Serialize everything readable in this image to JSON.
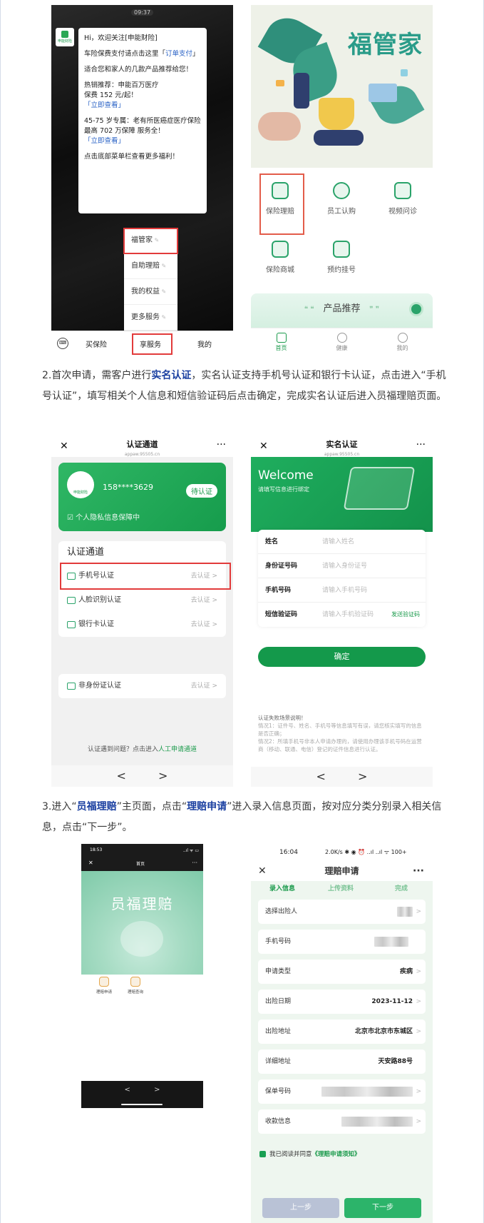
{
  "shot1": {
    "time": "09:37",
    "avatar_text": "申能财险",
    "msg_greeting": "Hi，欢迎关注[申能财险]",
    "msg_autopay_prefix": "车险保费支付请点击这里「",
    "msg_autopay_link": "订单支付",
    "msg_autopay_suffix": "」",
    "msg_recommend": "适合您和家人的几款产品推荐给您！",
    "msg_hot_title": "热销推荐：申能百万医疗",
    "msg_hot_price": "保费 152 元/起！",
    "msg_hot_link": "「立即查看」",
    "msg_age_title": "45-75 岁专属：老有所医癌症医疗保险",
    "msg_age_cover": "最高 702 万保障 服务全！",
    "msg_age_link": "「立即查看」",
    "msg_footer": "点击底部菜单栏查看更多福利！",
    "menu": [
      "福管家",
      "自助理赔",
      "我的权益",
      "更多服务"
    ],
    "tabs": [
      "买保险",
      "享服务",
      "我的"
    ]
  },
  "shot2": {
    "title": "福管家",
    "grid": [
      "保险理赔",
      "员工认购",
      "视频问诊",
      "保险商城",
      "预约挂号"
    ],
    "product_rec": "产品推荐",
    "bottom_tabs": [
      "首页",
      "健康",
      "我的"
    ]
  },
  "para2": {
    "part1": "2.首次申请，需客户进行",
    "bold1": "实名认证",
    "part2": "，实名认证支持手机号认证和银行卡认证，点击进入“手机号认证”，填写相关个人信息和短信验证码后点击确定，完成实名认证后进入员福理赔页面。"
  },
  "shot3": {
    "title": "认证通道",
    "url": "appaw.95505.cn",
    "logo_text": "申能财险",
    "phone": "158****3629",
    "badge": "待认证",
    "privacy": "个人隐私信息保障中",
    "section": "认证通道",
    "rows": [
      "手机号认证",
      "人脸识别认证",
      "银行卡认证"
    ],
    "row_action": "去认证 >",
    "row_extra": "非身份证认证",
    "help_prefix": "认证遇到问题？点击进入",
    "help_link": "人工申请通道",
    "nav": "<  >"
  },
  "shot4": {
    "title": "实名认证",
    "url": "appaw.95505.cn",
    "welcome": "Welcome",
    "welcome_sub": "请填写信息进行绑定",
    "fields": [
      {
        "label": "姓名",
        "ph": "请输入姓名"
      },
      {
        "label": "身份证号码",
        "ph": "请输入身份证号"
      },
      {
        "label": "手机号码",
        "ph": "请输入手机号码"
      },
      {
        "label": "短信验证码",
        "ph": "请输入手机验证码"
      }
    ],
    "sms_btn": "发送验证码",
    "confirm": "确定",
    "note_title": "认证失败场景说明！",
    "note_1": "情况1：证件号、姓名、手机号等信息填写有误，请您核实填写的信息是否正确；",
    "note_2": "情况2：所填手机号非本人申请办理的，请使用办理该手机号码在运营商（移动、联通、电信）登记的证件信息进行认证。",
    "nav": "<  >"
  },
  "para3": {
    "part1": "3.进入“",
    "bold1": "员福理赔",
    "part2": "”主页面，点击“",
    "bold2": "理赔申请",
    "part3": "”进入录入信息页面，按对应分类分别录入相关信息，点击“下一步”。"
  },
  "shot5": {
    "status_time": "18:53",
    "status_right": "..ıl ᯤ ▭",
    "nav_x": "✕",
    "nav_title": "首页",
    "nav_dots": "···",
    "hero_title": "员福理赔",
    "icon1": "理赔申请",
    "icon2": "理赔查询",
    "nav": "<  >"
  },
  "shot6": {
    "status_time": "16:04",
    "status_right": "2.0K/s ✱ ◉ ⏰ ..ıl ..ıl ᯤ 100+",
    "title": "理赔申请",
    "steps": [
      "录入信息",
      "上传资料",
      "完成"
    ],
    "fields": [
      {
        "label": "选择出险人",
        "value": ""
      },
      {
        "label": "手机号码",
        "value": ""
      },
      {
        "label": "申请类型",
        "value": "疾病"
      },
      {
        "label": "出险日期",
        "value": "2023-11-12"
      },
      {
        "label": "出险地址",
        "value": "北京市北京市东城区"
      },
      {
        "label": "详细地址",
        "value": "天安路88号"
      },
      {
        "label": "保单号码",
        "value": ""
      },
      {
        "label": "收款信息",
        "value": ""
      }
    ],
    "agree_prefix": "我已阅读并同意",
    "agree_link": "《理赔申请须知》",
    "prev": "上一步",
    "next": "下一步"
  }
}
